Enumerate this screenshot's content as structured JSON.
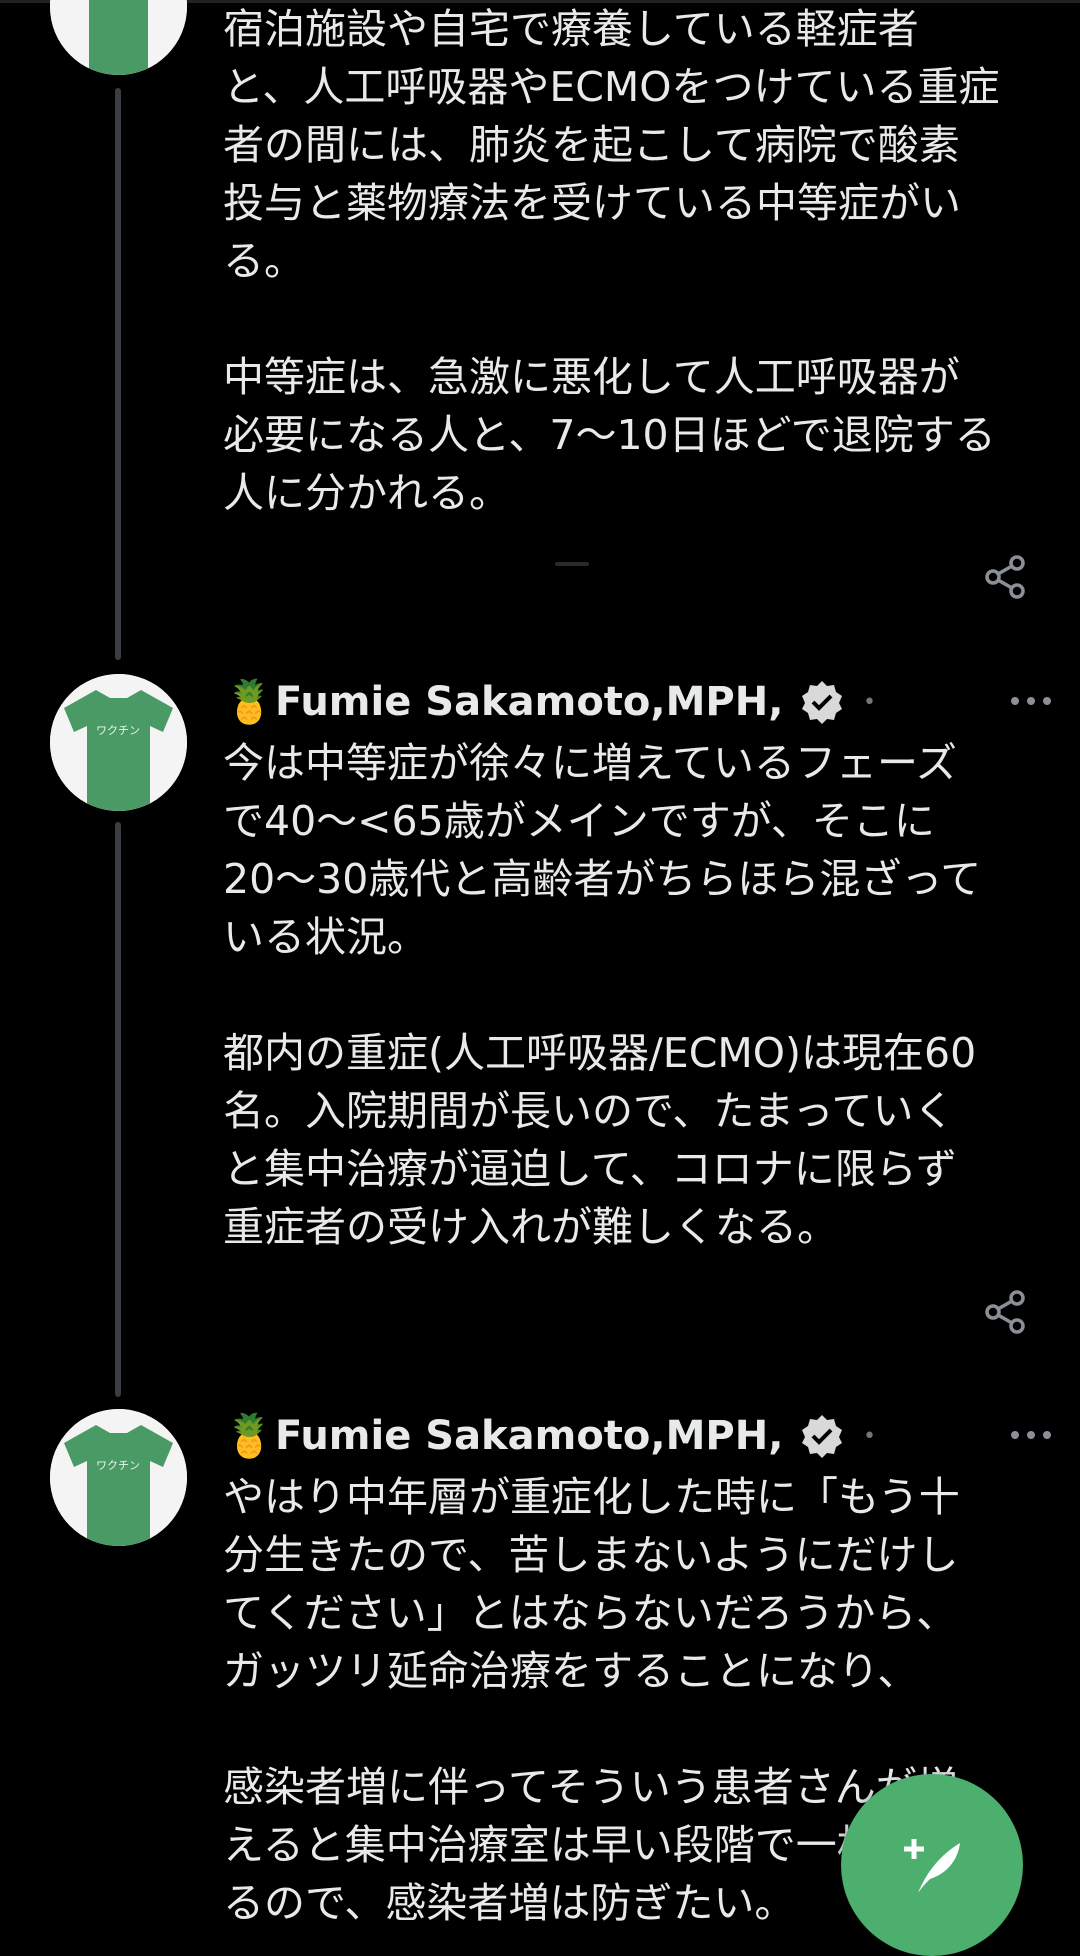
{
  "tweets": [
    {
      "text": "宿泊施設や自宅で療養している軽症者\nと、人工呼吸器やECMOをつけている重症\n者の間には、肺炎を起こして病院で酸素\n投与と薬物療法を受けている中等症がい\nる。\n\n中等症は、急激に悪化して人工呼吸器が\n必要になる人と、7〜10日ほどで退院する\n人に分かれる。"
    },
    {
      "author": "Fumie Sakamoto,MPH,...",
      "text": "今は中等症が徐々に増えているフェーズ\nで40〜<65歳がメインですが、そこに\n20〜30歳代と高齢者がちらほら混ざって\nいる状況。\n\n都内の重症(人工呼吸器/ECMO)は現在60\n名。入院期間が長いので、たまっていく\nと集中治療が逼迫して、コロナに限らず\n重症者の受け入れが難しくなる。"
    },
    {
      "author": "Fumie Sakamoto,MPH,...",
      "text": "やはり中年層が重症化した時に「もう十\n分生きたので、苦しまないようにだけし\nてください」とはならないだろうから、\nガッツリ延命治療をすることになり、\n\n感染者増に伴ってそういう患者さんが増\nえると集中治療室は早い段階で一杯にな\nるので、感染者増は防ぎたい。"
    }
  ],
  "icons": {
    "author_emoji": "🍍",
    "verified": "verified-badge-icon",
    "more": "more-icon",
    "share": "share-icon",
    "compose": "compose-tweet-icon"
  },
  "colors": {
    "accent": "#4caf6d",
    "background": "#000000",
    "text": "#e7e9ea",
    "thread_line": "#3a3d41"
  }
}
